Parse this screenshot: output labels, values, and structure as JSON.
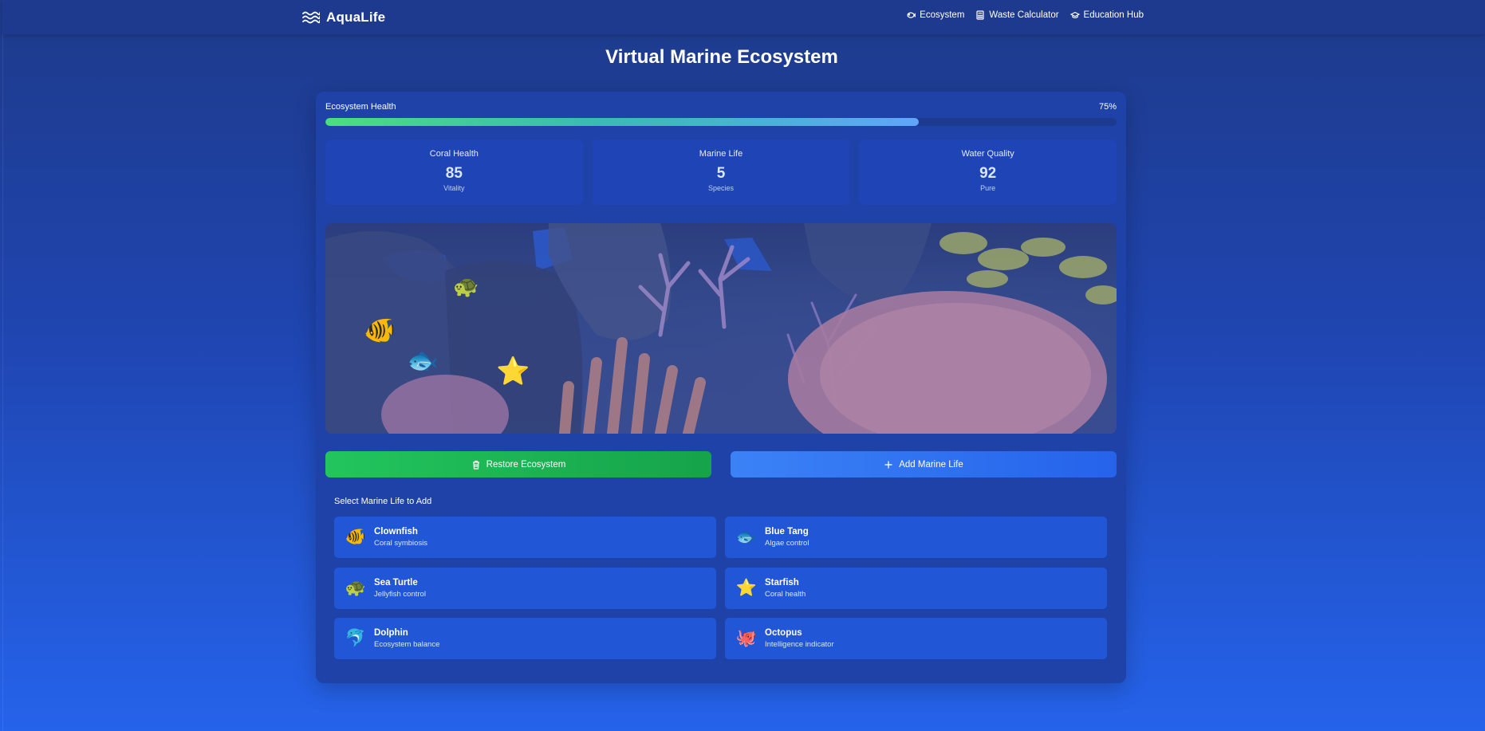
{
  "nav": {
    "brand": "AquaLife",
    "links": [
      {
        "label": "Ecosystem",
        "icon": "fish-icon"
      },
      {
        "label": "Waste Calculator",
        "icon": "calculator-icon"
      },
      {
        "label": "Education Hub",
        "icon": "graduation-cap-icon"
      }
    ]
  },
  "page": {
    "title": "Virtual Marine Ecosystem"
  },
  "health": {
    "label": "Ecosystem Health",
    "value_text": "75%",
    "percent": 75
  },
  "stats": [
    {
      "title": "Coral Health",
      "value": "85",
      "sub": "Vitality"
    },
    {
      "title": "Marine Life",
      "value": "5",
      "sub": "Species"
    },
    {
      "title": "Water Quality",
      "value": "92",
      "sub": "Pure"
    }
  ],
  "aquarium": {
    "creatures": [
      "🐢",
      "🐠",
      "🐟",
      "⭐"
    ]
  },
  "buttons": {
    "restore": "Restore Ecosystem",
    "add": "Add Marine Life"
  },
  "selector": {
    "title": "Select Marine Life to Add",
    "items": [
      {
        "emoji": "🐠",
        "name": "Clownfish",
        "desc": "Coral symbiosis"
      },
      {
        "emoji": "🐟",
        "name": "Blue Tang",
        "desc": "Algae control"
      },
      {
        "emoji": "🐢",
        "name": "Sea Turtle",
        "desc": "Jellyfish control"
      },
      {
        "emoji": "⭐",
        "name": "Starfish",
        "desc": "Coral health"
      },
      {
        "emoji": "🐬",
        "name": "Dolphin",
        "desc": "Ecosystem balance"
      },
      {
        "emoji": "🐙",
        "name": "Octopus",
        "desc": "Intelligence indicator"
      }
    ]
  },
  "colors": {
    "accent_green": "#22c55e",
    "accent_blue": "#3b82f6",
    "card": "#1f42a8"
  }
}
